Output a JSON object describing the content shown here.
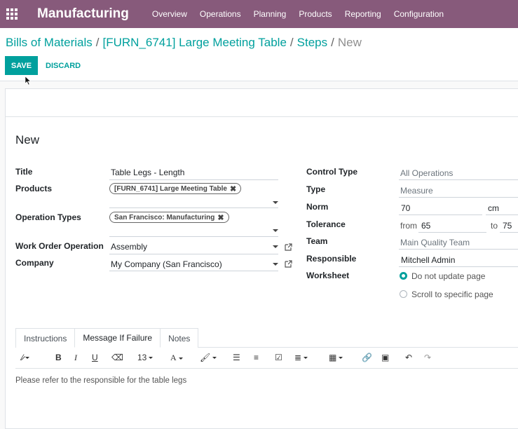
{
  "navbar": {
    "brand": "Manufacturing",
    "menu": [
      "Overview",
      "Operations",
      "Planning",
      "Products",
      "Reporting",
      "Configuration"
    ]
  },
  "breadcrumb": {
    "items": [
      "Bills of Materials",
      "[FURN_6741] Large Meeting Table",
      "Steps"
    ],
    "current": "New"
  },
  "buttons": {
    "save": "SAVE",
    "discard": "DISCARD"
  },
  "form": {
    "record_title": "New",
    "left": {
      "title_label": "Title",
      "title_value": "Table Legs - Length",
      "products_label": "Products",
      "products_tag": "[FURN_6741] Large Meeting Table",
      "operation_types_label": "Operation Types",
      "operation_types_tag": "San Francisco: Manufacturing",
      "work_order_operation_label": "Work Order Operation",
      "work_order_operation_value": "Assembly",
      "company_label": "Company",
      "company_value": "My Company (San Francisco)"
    },
    "right": {
      "control_type_label": "Control Type",
      "control_type_value": "All Operations",
      "type_label": "Type",
      "type_value": "Measure",
      "norm_label": "Norm",
      "norm_value": "70",
      "norm_unit": "cm",
      "tolerance_label": "Tolerance",
      "tolerance_from_label": "from",
      "tolerance_from": "65",
      "tolerance_to_label": "to",
      "tolerance_to": "75",
      "team_label": "Team",
      "team_value": "Main Quality Team",
      "responsible_label": "Responsible",
      "responsible_value": "Mitchell Admin",
      "worksheet_label": "Worksheet",
      "worksheet_options": [
        "Do not update page",
        "Scroll to specific page"
      ],
      "worksheet_selected": "Do not update page"
    }
  },
  "notebook": {
    "tabs": [
      "Instructions",
      "Message If Failure",
      "Notes"
    ],
    "active_tab": "Message If Failure",
    "font_size": "13",
    "content": "Please refer to the responsible for the table legs"
  },
  "colors": {
    "navbar": "#875a7b",
    "primary": "#00a09d"
  }
}
